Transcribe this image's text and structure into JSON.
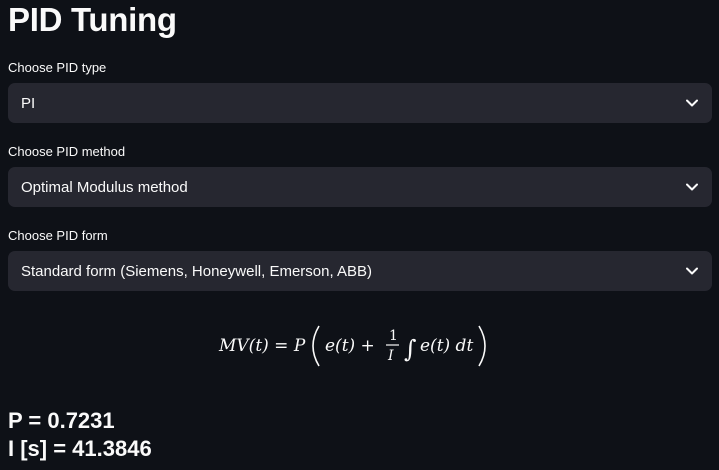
{
  "page": {
    "title": "PID Tuning"
  },
  "fields": [
    {
      "label": "Choose PID type",
      "value": "PI"
    },
    {
      "label": "Choose PID method",
      "value": "Optimal Modulus method"
    },
    {
      "label": "Choose PID form",
      "value": "Standard form (Siemens, Honeywell, Emerson, ABB)"
    }
  ],
  "formula": {
    "lhs": "MV(t) = P",
    "term1": "e(t) +",
    "frac_num": "1",
    "frac_den": "I",
    "integral": "∫",
    "term2": "e(t) dt"
  },
  "results": {
    "p_line": "P = 0.7231",
    "i_line": "I [s] = 41.3846"
  },
  "icons": {
    "dropdown": "chevron-down-icon"
  },
  "colors": {
    "background": "#0e1117",
    "input_bg": "#262730",
    "text": "#fafafa"
  }
}
